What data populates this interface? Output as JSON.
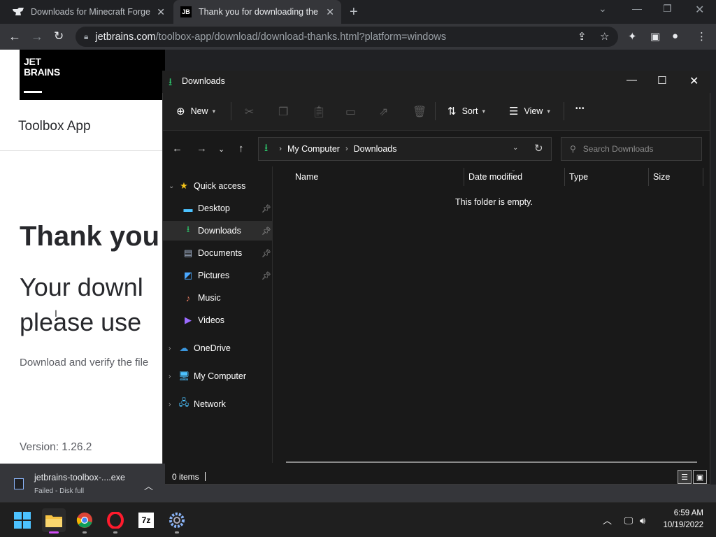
{
  "browser": {
    "tabs": [
      {
        "title": "Downloads for Minecraft Forge f",
        "favicon": "curseforge-icon"
      },
      {
        "title": "Thank you for downloading the T",
        "favicon": "jb-favicon",
        "active": true
      }
    ],
    "url_domain": "jetbrains.com",
    "url_path": "/toolbox-app/download/download-thanks.html?platform=windows"
  },
  "webpage": {
    "logo_line1": "JET",
    "logo_line2": "BRAINS",
    "subheader": "Toolbox App",
    "heading": "Thank you",
    "subheading_line1": "Your downl",
    "subheading_line2": "please use",
    "verify_text": "Download and verify the file",
    "version": "Version: 1.26.2"
  },
  "explorer": {
    "title": "Downloads",
    "commands": {
      "new": "New",
      "sort": "Sort",
      "view": "View",
      "more": "•••"
    },
    "breadcrumb": [
      "My Computer",
      "Downloads"
    ],
    "search_placeholder": "Search Downloads",
    "nav": {
      "quick_access": "Quick access",
      "items": [
        "Desktop",
        "Downloads",
        "Documents",
        "Pictures",
        "Music",
        "Videos"
      ],
      "onedrive": "OneDrive",
      "my_computer": "My Computer",
      "network": "Network"
    },
    "columns": {
      "name": "Name",
      "date": "Date modified",
      "type": "Type",
      "size": "Size"
    },
    "empty_message": "This folder is empty.",
    "status": "0 items"
  },
  "download_shelf": {
    "file": "jetbrains-toolbox-....exe",
    "status": "Failed - Disk full"
  },
  "taskbar": {
    "time": "6:59 AM",
    "date": "10/19/2022"
  },
  "colors": {
    "accent_green": "#2dc56b",
    "selection": "#2d2d2d",
    "taskbar_active": "#d04bf5"
  }
}
